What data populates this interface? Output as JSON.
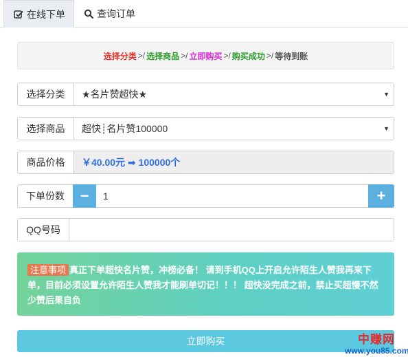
{
  "tabs": [
    {
      "label": "在线下单",
      "icon": "checkbox-edit-icon",
      "active": true
    },
    {
      "label": "查询订单",
      "icon": "search-icon",
      "active": false
    }
  ],
  "steps": {
    "items": [
      {
        "label": "选择分类",
        "color": "#e5332a"
      },
      {
        "label": "选择商品",
        "color": "#2e9e2e"
      },
      {
        "label": "立即购买",
        "color": "#d62ad6"
      },
      {
        "label": "购买成功",
        "color": "#2e9e2e"
      },
      {
        "label": "等待到账",
        "color": "#555555"
      }
    ],
    "separator": ">/"
  },
  "form": {
    "category": {
      "label": "选择分类",
      "value": "★名片赞超快★"
    },
    "product": {
      "label": "选择商品",
      "value": "超快┊名片赞100000"
    },
    "price": {
      "label": "商品价格",
      "value": "￥40.00元 ➡ 100000个"
    },
    "quantity": {
      "label": "下单份数",
      "value": "1",
      "minus": "−",
      "plus": "+"
    },
    "qq": {
      "label": "QQ号码",
      "value": ""
    }
  },
  "notice": {
    "tag": "注意事项",
    "text": "真正下单超快名片赞，冲榜必备！ 请到手机QQ上开启允许陌生人赞我再来下单，目前必须设置允许陌生人赞我才能刷单切记！！！ 超快没完成之前，禁止买超慢不然少赞后果自负"
  },
  "buy_button": "立即购买",
  "watermark": {
    "line1": "中赚网",
    "line2": "www.you85.com"
  }
}
